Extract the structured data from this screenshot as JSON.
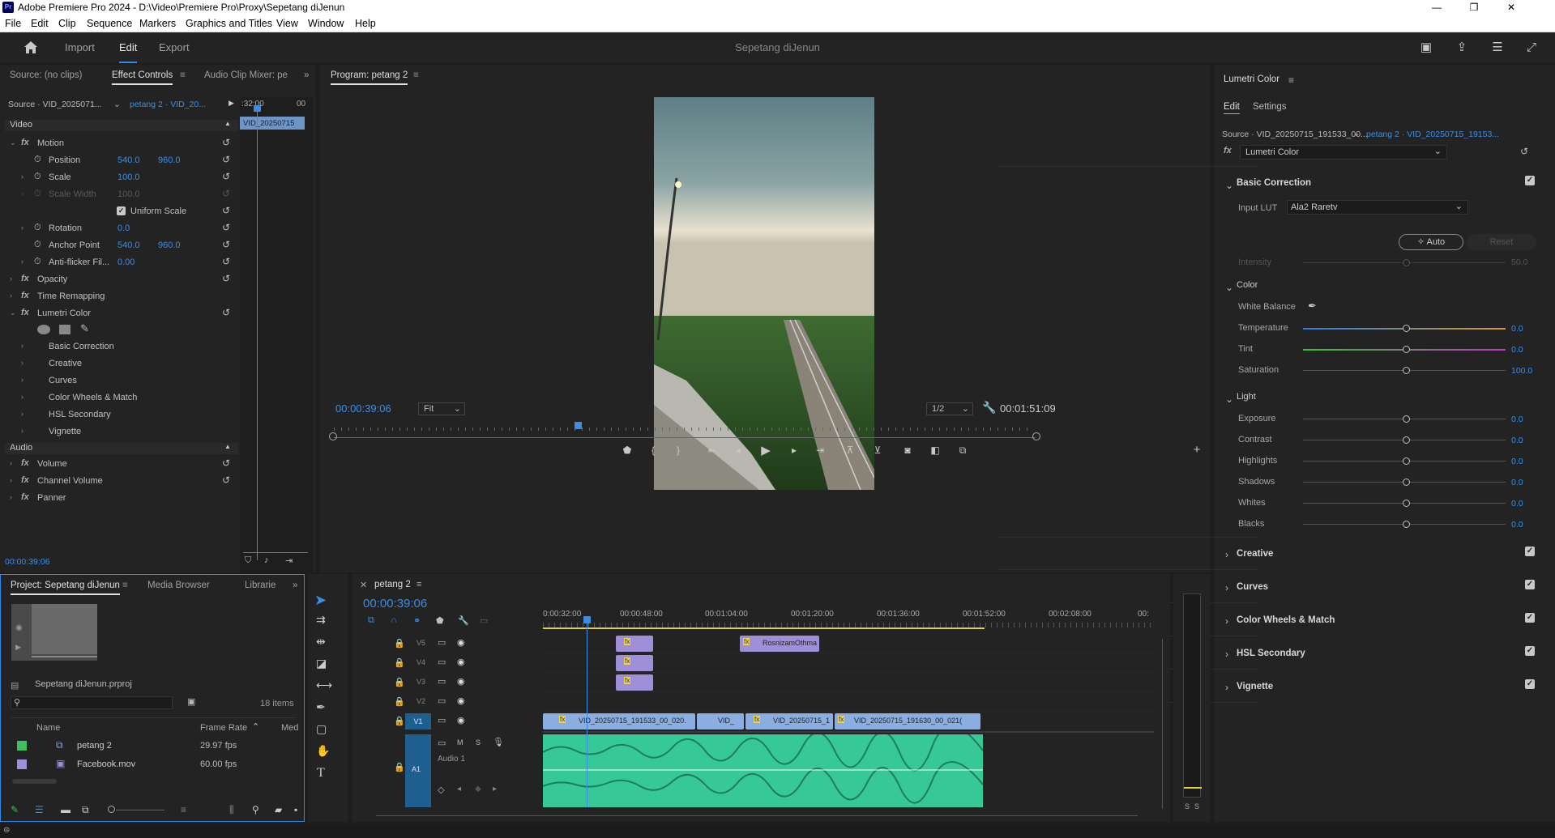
{
  "window": {
    "title": "Adobe Premiere Pro 2024 - D:\\Video\\Premiere Pro\\Proxy\\Sepetang diJenun",
    "app_icon": "Pr",
    "minimize": "—",
    "maximize": "❐",
    "close": "✕"
  },
  "menu": [
    "File",
    "Edit",
    "Clip",
    "Sequence",
    "Markers",
    "Graphics and Titles",
    "View",
    "Window",
    "Help"
  ],
  "header": {
    "home_icon": "home-icon",
    "tabs": [
      "Import",
      "Edit",
      "Export"
    ],
    "active_tab": "Edit",
    "project_title": "Sepetang diJenun"
  },
  "source_panel": {
    "tabs": [
      "Source: (no clips)",
      "Effect Controls",
      "Audio Clip Mixer: pe"
    ],
    "active": "Effect Controls",
    "more": "»"
  },
  "effect_controls": {
    "source_label": "Source · VID_2025071...",
    "sequence_label": "petang 2 · VID_20...",
    "ruler_start": ":32:00",
    "ruler_end": "00",
    "clip_name": "VID_20250715",
    "video_header": "Video",
    "motion": "Motion",
    "position": {
      "label": "Position",
      "x": "540.0",
      "y": "960.0"
    },
    "scale": {
      "label": "Scale",
      "value": "100.0"
    },
    "scale_width": {
      "label": "Scale Width",
      "value": "100.0"
    },
    "uniform_scale": "Uniform Scale",
    "rotation": {
      "label": "Rotation",
      "value": "0.0"
    },
    "anchor_point": {
      "label": "Anchor Point",
      "x": "540.0",
      "y": "960.0"
    },
    "anti_flicker": {
      "label": "Anti-flicker Fil...",
      "value": "0.00"
    },
    "opacity": "Opacity",
    "time_remapping": "Time Remapping",
    "lumetri": "Lumetri Color",
    "lumetri_items": [
      "Basic Correction",
      "Creative",
      "Curves",
      "Color Wheels & Match",
      "HSL Secondary",
      "Vignette"
    ],
    "audio_header": "Audio",
    "volume": "Volume",
    "channel_volume": "Channel Volume",
    "panner": "Panner",
    "timecode": "00:00:39:06"
  },
  "program": {
    "title": "Program: petang 2",
    "timecode": "00:00:39:06",
    "fit": "Fit",
    "resolution": "1/2",
    "duration": "00:01:51:09",
    "playhead_fraction": 0.35
  },
  "lumetri_panel": {
    "title": "Lumetri Color",
    "tabs": [
      "Edit",
      "Settings"
    ],
    "source": "Source · VID_20250715_191533_00...",
    "sequence": "petang 2 · VID_20250715_19153...",
    "effect_select": "Lumetri Color",
    "basic_correction": "Basic Correction",
    "input_lut_label": "Input LUT",
    "input_lut": "Ala2 Raretv",
    "auto": "Auto",
    "reset": "Reset",
    "intensity": {
      "label": "Intensity",
      "value": "50.0"
    },
    "color_section": "Color",
    "white_balance": "White Balance",
    "color_sliders": [
      {
        "label": "Temperature",
        "value": "0.0"
      },
      {
        "label": "Tint",
        "value": "0.0"
      },
      {
        "label": "Saturation",
        "value": "100.0"
      }
    ],
    "light_section": "Light",
    "light_sliders": [
      {
        "label": "Exposure",
        "value": "0.0"
      },
      {
        "label": "Contrast",
        "value": "0.0"
      },
      {
        "label": "Highlights",
        "value": "0.0"
      },
      {
        "label": "Shadows",
        "value": "0.0"
      },
      {
        "label": "Whites",
        "value": "0.0"
      },
      {
        "label": "Blacks",
        "value": "0.0"
      }
    ],
    "sections": [
      "Creative",
      "Curves",
      "Color Wheels & Match",
      "HSL Secondary",
      "Vignette"
    ]
  },
  "project_panel": {
    "tabs": [
      "Project: Sepetang diJenun",
      "Media Browser",
      "Librarie"
    ],
    "more": "»",
    "project_file": "Sepetang diJenun.prproj",
    "item_count": "18 items",
    "columns": [
      "Name",
      "Frame Rate",
      "Med"
    ],
    "items": [
      {
        "name": "petang 2",
        "rate": "29.97 fps",
        "color": "#3fbf5f"
      },
      {
        "name": "Facebook.mov",
        "rate": "60.00 fps",
        "color": "#9f8fd9"
      }
    ]
  },
  "timeline": {
    "tab": "petang 2",
    "timecode": "00:00:39:06",
    "ruler": [
      "0:00:32:00",
      "00:00:48:00",
      "00:01:04:00",
      "00:01:20:00",
      "00:01:36:00",
      "00:01:52:00",
      "00:02:08:00",
      "00:"
    ],
    "tracks": [
      "V5",
      "V4",
      "V3",
      "V2",
      "V1",
      "A1"
    ],
    "audio_track_name": "Audio 1",
    "clips": {
      "title": "RosnizamOthma",
      "v1": [
        "VID_20250715_191533_00_020.",
        "VID_",
        "VID_20250715_1",
        "VID_20250715_191630_00_021("
      ],
      "fx": "fx"
    }
  },
  "audio_meter": {
    "labels": [
      "S",
      "S"
    ]
  }
}
